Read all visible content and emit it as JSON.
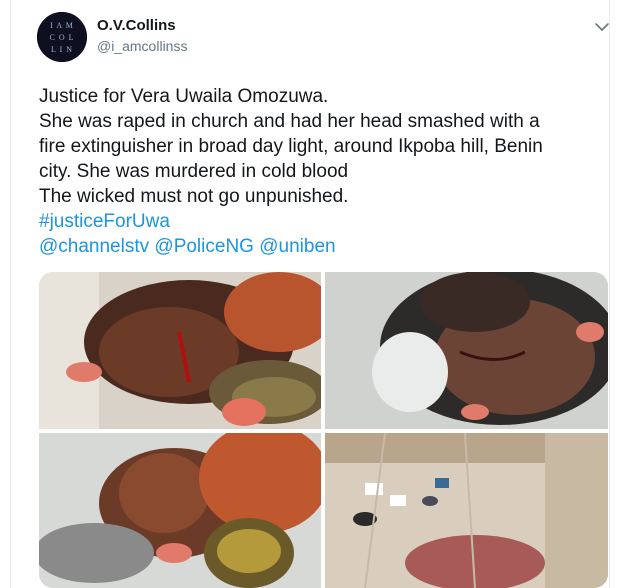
{
  "tweet": {
    "author": {
      "name": "O.V.Collins",
      "handle": "@i_amcollinss",
      "avatar_text": [
        "I A M",
        "C O L",
        "L I N"
      ]
    },
    "text_lines": [
      "Justice for Vera Uwaila Omozuwa.",
      "She was raped in church and had her head smashed with a",
      "fire extinguisher in broad day light, around Ikpoba hill, Benin",
      "city. She was murdered in cold blood",
      "The wicked must not go unpunished."
    ],
    "hashtag": "#justiceForUwa",
    "mentions": [
      "@channelstv",
      "@PoliceNG",
      "@uniben"
    ],
    "media_count": 4
  },
  "icons": {
    "menu": "chevron-down-icon"
  },
  "colors": {
    "link": "#1b95e0",
    "text": "#14171a",
    "secondary": "#657786",
    "border": "#e6ecf0"
  }
}
